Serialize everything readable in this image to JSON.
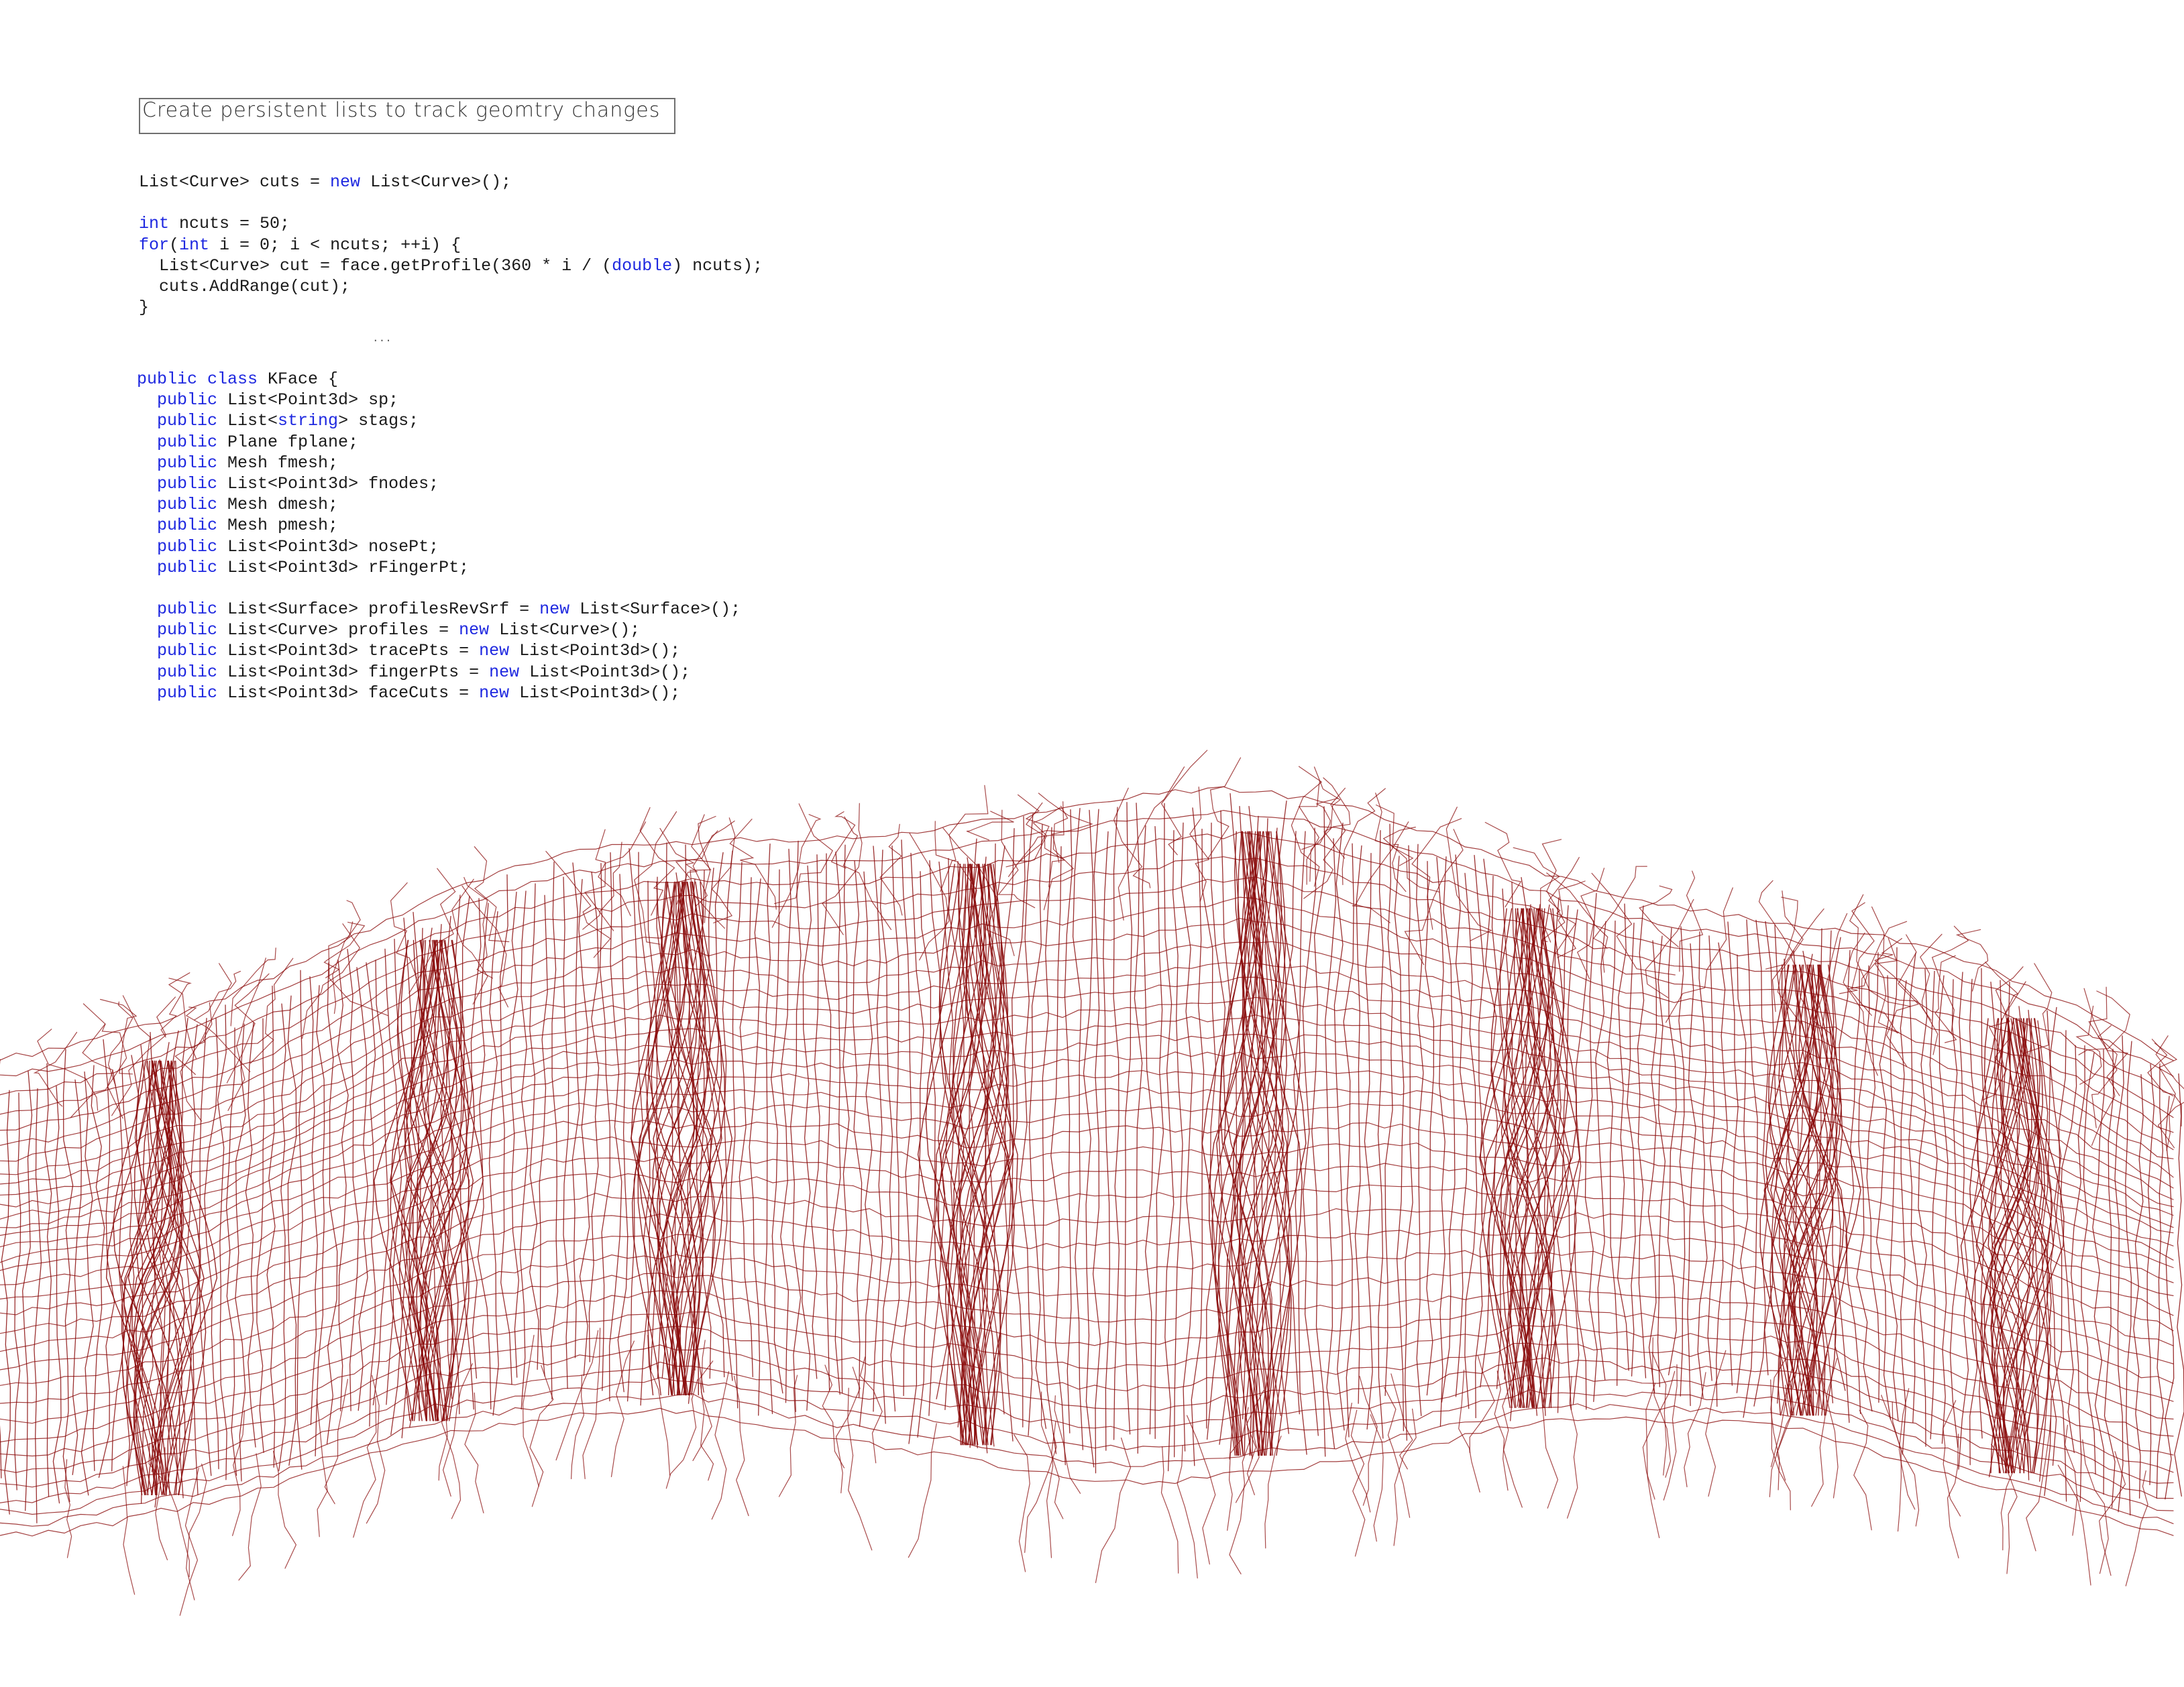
{
  "heading": "Create persistent lists to track geomtry changes",
  "ellipsis": "...",
  "loop_block": [
    [
      {
        "t": "tx",
        "v": "List<Curve> cuts = "
      },
      {
        "t": "kw",
        "v": "new"
      },
      {
        "t": "tx",
        "v": " List<Curve>();"
      }
    ],
    [],
    [
      {
        "t": "kw",
        "v": "int"
      },
      {
        "t": "tx",
        "v": " ncuts = 50;"
      }
    ],
    [
      {
        "t": "kw",
        "v": "for"
      },
      {
        "t": "tx",
        "v": "("
      },
      {
        "t": "kw",
        "v": "int"
      },
      {
        "t": "tx",
        "v": " i = 0; i < ncuts; ++i) {"
      }
    ],
    [
      {
        "t": "tx",
        "v": "  List<Curve> cut = face.getProfile(360 * i / ("
      },
      {
        "t": "kw",
        "v": "double"
      },
      {
        "t": "tx",
        "v": ") ncuts);"
      }
    ],
    [
      {
        "t": "tx",
        "v": "  cuts.AddRange(cut);"
      }
    ],
    [
      {
        "t": "tx",
        "v": "}"
      }
    ]
  ],
  "class_block": [
    [
      {
        "t": "kw",
        "v": "public class"
      },
      {
        "t": "tx",
        "v": " KFace {"
      }
    ],
    [
      {
        "t": "tx",
        "v": "  "
      },
      {
        "t": "kw",
        "v": "public"
      },
      {
        "t": "tx",
        "v": " List<Point3d> sp;"
      }
    ],
    [
      {
        "t": "tx",
        "v": "  "
      },
      {
        "t": "kw",
        "v": "public"
      },
      {
        "t": "tx",
        "v": " List<"
      },
      {
        "t": "kw",
        "v": "string"
      },
      {
        "t": "tx",
        "v": "> stags;"
      }
    ],
    [
      {
        "t": "tx",
        "v": "  "
      },
      {
        "t": "kw",
        "v": "public"
      },
      {
        "t": "tx",
        "v": " Plane fplane;"
      }
    ],
    [
      {
        "t": "tx",
        "v": "  "
      },
      {
        "t": "kw",
        "v": "public"
      },
      {
        "t": "tx",
        "v": " Mesh fmesh;"
      }
    ],
    [
      {
        "t": "tx",
        "v": "  "
      },
      {
        "t": "kw",
        "v": "public"
      },
      {
        "t": "tx",
        "v": " List<Point3d> fnodes;"
      }
    ],
    [
      {
        "t": "tx",
        "v": "  "
      },
      {
        "t": "kw",
        "v": "public"
      },
      {
        "t": "tx",
        "v": " Mesh dmesh;"
      }
    ],
    [
      {
        "t": "tx",
        "v": "  "
      },
      {
        "t": "kw",
        "v": "public"
      },
      {
        "t": "tx",
        "v": " Mesh pmesh;"
      }
    ],
    [
      {
        "t": "tx",
        "v": "  "
      },
      {
        "t": "kw",
        "v": "public"
      },
      {
        "t": "tx",
        "v": " List<Point3d> nosePt;"
      }
    ],
    [
      {
        "t": "tx",
        "v": "  "
      },
      {
        "t": "kw",
        "v": "public"
      },
      {
        "t": "tx",
        "v": " List<Point3d> rFingerPt;"
      }
    ],
    [],
    [
      {
        "t": "tx",
        "v": "  "
      },
      {
        "t": "kw",
        "v": "public"
      },
      {
        "t": "tx",
        "v": " List<Surface> profilesRevSrf = "
      },
      {
        "t": "kw",
        "v": "new"
      },
      {
        "t": "tx",
        "v": " List<Surface>();"
      }
    ],
    [
      {
        "t": "tx",
        "v": "  "
      },
      {
        "t": "kw",
        "v": "public"
      },
      {
        "t": "tx",
        "v": " List<Curve> profiles = "
      },
      {
        "t": "kw",
        "v": "new"
      },
      {
        "t": "tx",
        "v": " List<Curve>();"
      }
    ],
    [
      {
        "t": "tx",
        "v": "  "
      },
      {
        "t": "kw",
        "v": "public"
      },
      {
        "t": "tx",
        "v": " List<Point3d> tracePts = "
      },
      {
        "t": "kw",
        "v": "new"
      },
      {
        "t": "tx",
        "v": " List<Point3d>();"
      }
    ],
    [
      {
        "t": "tx",
        "v": "  "
      },
      {
        "t": "kw",
        "v": "public"
      },
      {
        "t": "tx",
        "v": " List<Point3d> fingerPts = "
      },
      {
        "t": "kw",
        "v": "new"
      },
      {
        "t": "tx",
        "v": " List<Point3d>();"
      }
    ],
    [
      {
        "t": "tx",
        "v": "  "
      },
      {
        "t": "kw",
        "v": "public"
      },
      {
        "t": "tx",
        "v": " List<Point3d> faceCuts = "
      },
      {
        "t": "kw",
        "v": "new"
      },
      {
        "t": "tx",
        "v": " List<Point3d>();"
      }
    ]
  ],
  "colors": {
    "keyword": "#1e28e0",
    "text": "#1a1a1a",
    "wire": "#8b0d0d"
  },
  "illustration": {
    "icon": "wireframe-face-profiles"
  }
}
